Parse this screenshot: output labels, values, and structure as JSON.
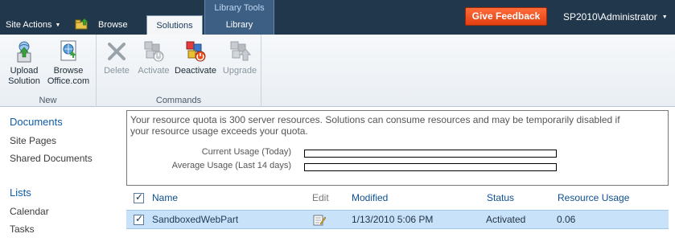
{
  "topbar": {
    "site_actions": "Site Actions",
    "tab_browse": "Browse",
    "tab_solutions": "Solutions",
    "context_group_label": "Library Tools",
    "tab_library": "Library",
    "give_feedback": "Give Feedback",
    "user": "SP2010\\Administrator"
  },
  "ribbon": {
    "groups": [
      {
        "label": "New",
        "buttons": [
          {
            "line1": "Upload",
            "line2": "Solution",
            "icon": "upload-solution-icon",
            "enabled": true
          },
          {
            "line1": "Browse",
            "line2": "Office.com",
            "icon": "browse-office-icon",
            "enabled": true
          }
        ]
      },
      {
        "label": "Commands",
        "buttons": [
          {
            "line1": "Delete",
            "line2": "",
            "icon": "delete-icon",
            "enabled": false
          },
          {
            "line1": "Activate",
            "line2": "",
            "icon": "activate-icon",
            "enabled": false
          },
          {
            "line1": "Deactivate",
            "line2": "",
            "icon": "deactivate-icon",
            "enabled": true
          },
          {
            "line1": "Upgrade",
            "line2": "",
            "icon": "upgrade-icon",
            "enabled": false
          }
        ]
      }
    ]
  },
  "leftnav": {
    "documents_heading": "Documents",
    "documents_items": [
      "Site Pages",
      "Shared Documents"
    ],
    "lists_heading": "Lists",
    "lists_items": [
      "Calendar",
      "Tasks"
    ]
  },
  "quota": {
    "message_line1": "Your resource quota is 300 server resources. Solutions can consume resources and may be temporarily disabled if",
    "message_line2": "your resource usage exceeds your quota.",
    "current_label": "Current Usage (Today)",
    "average_label": "Average Usage (Last 14 days)",
    "current_fraction": 0.0,
    "average_fraction": 0.0
  },
  "list": {
    "columns": {
      "name": "Name",
      "edit": "Edit",
      "modified": "Modified",
      "status": "Status",
      "resource_usage": "Resource Usage"
    },
    "rows": [
      {
        "name": "SandboxedWebPart",
        "modified": "1/13/2010 5:06 PM",
        "status": "Activated",
        "resource_usage": "0.06",
        "selected": true
      }
    ]
  },
  "colors": {
    "topbar": "#21374c",
    "feedback": "#e2521f",
    "link_blue": "#0e5ca8",
    "selected_row": "#c8e3f9"
  }
}
